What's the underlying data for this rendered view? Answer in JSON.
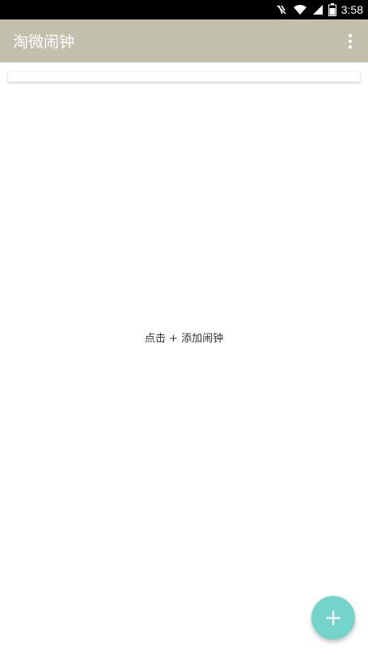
{
  "status_bar": {
    "time": "3:58",
    "icons": [
      "mute-icon",
      "wifi-icon",
      "signal-icon",
      "battery-icon"
    ]
  },
  "app_bar": {
    "title": "淘微闹钟",
    "background": "#c2bfad",
    "menu_icon": "overflow-menu-icon"
  },
  "main": {
    "empty_hint": "点击 + 添加闹钟"
  },
  "fab": {
    "label": "+",
    "icon": "add-icon",
    "color": "#74d4cc"
  }
}
